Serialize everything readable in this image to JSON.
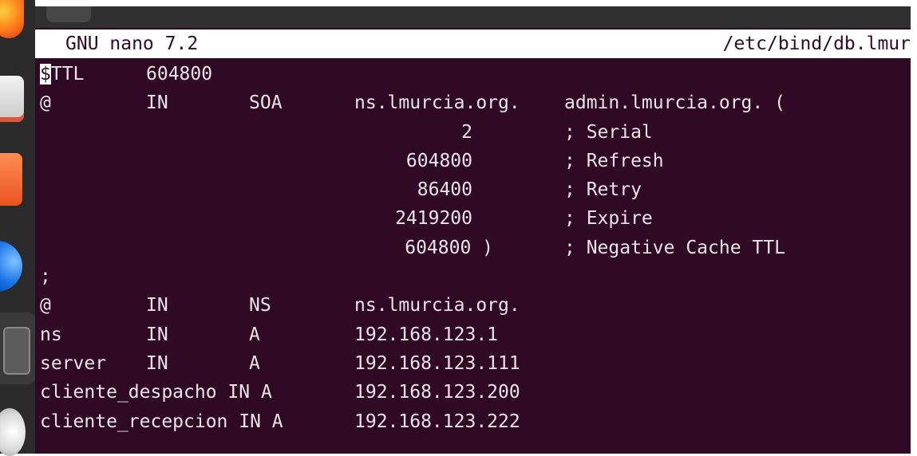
{
  "nano": {
    "version": "GNU nano 7.2",
    "filename": "/etc/bind/db.lmur"
  },
  "ttl": {
    "directive_cursor": "$",
    "directive_rest": "TTL",
    "value": "604800"
  },
  "soa": {
    "name": "@",
    "class": "IN",
    "type": "SOA",
    "primary_ns": "ns.lmurcia.org.",
    "admin": "admin.lmurcia.org. (",
    "fields": [
      {
        "value": "2",
        "comment": "; Serial"
      },
      {
        "value": "604800",
        "comment": "; Refresh"
      },
      {
        "value": "86400",
        "comment": "; Retry"
      },
      {
        "value": "2419200",
        "comment": "; Expire"
      },
      {
        "value": "604800 )",
        "comment": "; Negative Cache TTL"
      }
    ]
  },
  "separator": ";",
  "records": [
    {
      "name": "@",
      "class": "IN",
      "type": "NS",
      "value": "ns.lmurcia.org."
    },
    {
      "name": "ns",
      "class": "IN",
      "type": "A",
      "value": "192.168.123.1"
    },
    {
      "name": "server",
      "class": "IN",
      "type": "A",
      "value": "192.168.123.111"
    }
  ],
  "long_records": [
    {
      "text": "cliente_despacho IN A",
      "value": "192.168.123.200"
    },
    {
      "text": "cliente_recepcion IN A",
      "value": "192.168.123.222"
    }
  ],
  "colors": {
    "terminal_bg": "#300a24",
    "text": "#ebe3ea",
    "header_bg": "#ffffff"
  }
}
